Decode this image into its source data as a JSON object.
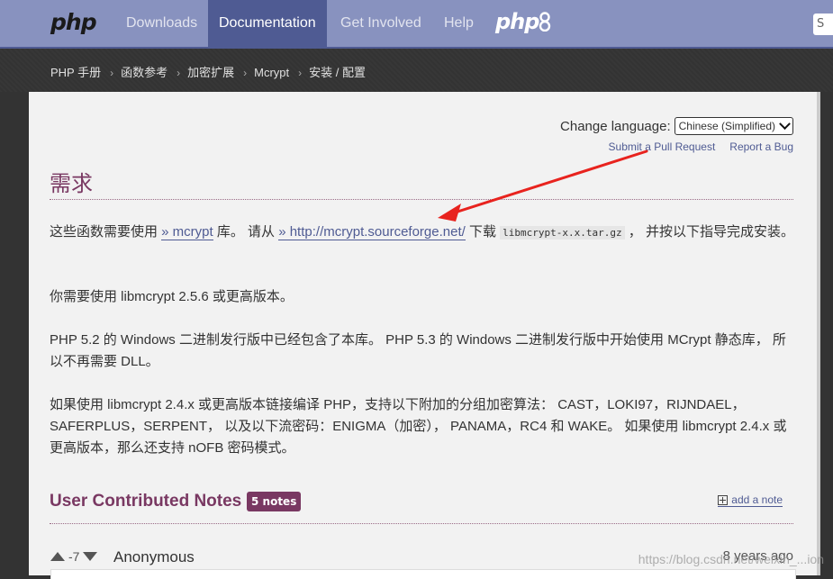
{
  "nav": {
    "logo": "php",
    "links": [
      "Downloads",
      "Documentation",
      "Get Involved",
      "Help"
    ],
    "active": "Documentation",
    "logo_right": "php",
    "search_stub": "S"
  },
  "breadcrumb": [
    "PHP 手册",
    "函数参考",
    "加密扩展",
    "Mcrypt",
    "安装 / 配置"
  ],
  "change_language": {
    "label": "Change language:",
    "selected": "Chinese (Simplified)"
  },
  "edit_links": {
    "pull_request": "Submit a Pull Request",
    "report_bug": "Report a Bug"
  },
  "section_title": "需求",
  "paragraphs": {
    "p1_a": "这些函数需要使用 ",
    "p1_link1": "» mcrypt",
    "p1_b": " 库。 请从 ",
    "p1_link2": "» http://mcrypt.sourceforge.net/",
    "p1_c": " 下载 ",
    "p1_code": "libmcrypt-x.x.tar.gz",
    "p1_d": " ， 并按以下指导完成安装。",
    "p2": "你需要使用 libmcrypt 2.5.6 或更高版本。",
    "p3": "PHP 5.2 的 Windows 二进制发行版中已经包含了本库。 PHP 5.3 的 Windows 二进制发行版中开始使用 MCrypt 静态库， 所以不再需要 DLL。",
    "p4": "如果使用 libmcrypt 2.4.x 或更高版本链接编译 PHP，支持以下附加的分组加密算法： CAST，LOKI97，RIJNDAEL，SAFERPLUS，SERPENT， 以及以下流密码：ENIGMA（加密）， PANAMA，RC4 和 WAKE。 如果使用 libmcrypt 2.4.x 或更高版本，那么还支持 nOFB 密码模式。"
  },
  "notes": {
    "heading": "User Contributed Notes",
    "count": "5 notes",
    "add_note": "add a note",
    "first": {
      "score": "-7",
      "author": "Anonymous",
      "ago": "8 years ago"
    }
  },
  "watermark": "https://blog.csdn.net/weixin_...ion",
  "colors": {
    "nav_bg": "#8892bf",
    "nav_active": "#4f5b93",
    "title": "#793862",
    "link": "#4f5b93",
    "arrow": "#e8231e"
  }
}
